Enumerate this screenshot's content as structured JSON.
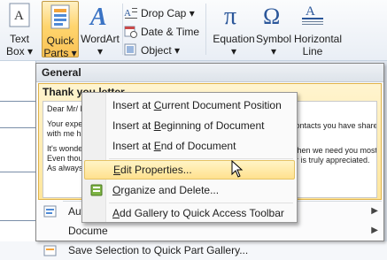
{
  "ribbon": {
    "text_box_label": "Text\nBox ▾",
    "quick_parts_label": "Quick\nParts ▾",
    "wordart_label": "WordArt\n▾",
    "drop_cap_label": "Drop Cap ▾",
    "date_time_label": "Date & Time",
    "object_label": "Object ▾",
    "equation_label": "Equation\n▾",
    "symbol_label": "Symbol\n▾",
    "horizontal_line_label": "Horizontal\nLine"
  },
  "quick_parts_menu": {
    "section_header": "General",
    "gallery_item_title": "Thank you letter",
    "preview": {
      "line1": "Dear Mr/ M",
      "line2": "Your expert",
      "line2_right": "contacts you have shared",
      "line3": "with me ha",
      "line4": "It's wonder",
      "line4_right": "when we need you most.",
      "line5": "Even thoug",
      "line5_right": "or is truly appreciated.",
      "line6": "As always, I"
    },
    "autotext_label": "Aut",
    "document_property_label": "Docume",
    "save_selection_label": "Save Selection to Quick Part Gallery...",
    "save_selection_underline": "S"
  },
  "context_menu": {
    "items": [
      {
        "pre": "Insert at ",
        "key": "C",
        "post": "urrent Document Position"
      },
      {
        "pre": "Insert at ",
        "key": "B",
        "post": "eginning of Document"
      },
      {
        "pre": "Insert at ",
        "key": "E",
        "post": "nd of Document"
      },
      {
        "pre": "",
        "key": "E",
        "post": "dit Properties..."
      },
      {
        "pre": "",
        "key": "O",
        "post": "rganize and Delete..."
      },
      {
        "pre": "",
        "key": "A",
        "post": "dd Gallery to Quick Access Toolbar"
      }
    ]
  },
  "colors": {
    "highlight": "#ffe18e",
    "ribbon_blue": "#2b579a",
    "menu_border": "#868686"
  }
}
